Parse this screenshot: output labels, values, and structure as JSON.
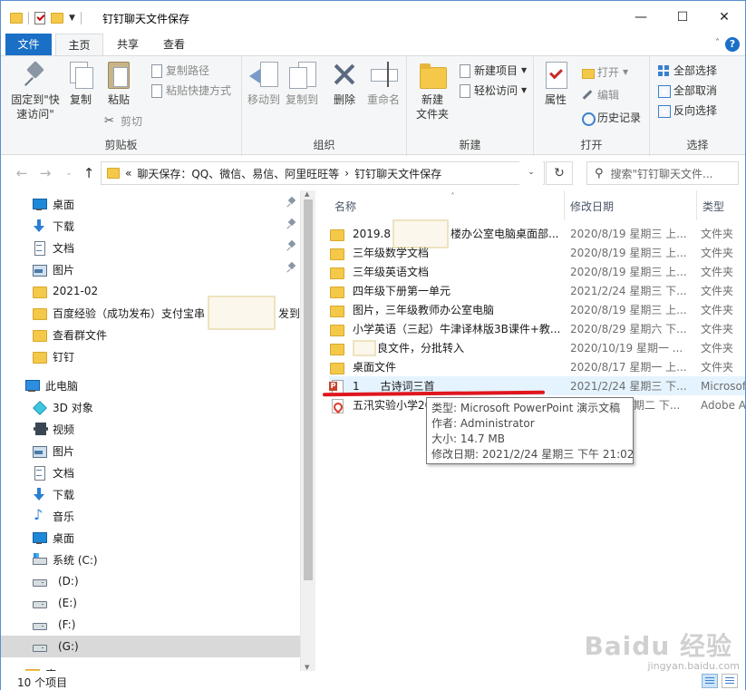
{
  "window": {
    "title": "钉钉聊天文件保存",
    "minimize": "—",
    "maximize": "☐",
    "close": "✕"
  },
  "ribbon_tabs": {
    "file": "文件",
    "home": "主页",
    "share": "共享",
    "view": "查看"
  },
  "ribbon": {
    "clipboard": {
      "label": "剪贴板",
      "pin": "固定到\"快\n速访问\"",
      "copy": "复制",
      "paste": "粘贴",
      "copy_path": "复制路径",
      "paste_shortcut": "粘贴快捷方式",
      "cut": "剪切"
    },
    "organize": {
      "label": "组织",
      "move_to": "移动到",
      "copy_to": "复制到",
      "delete": "删除",
      "rename": "重命名"
    },
    "new": {
      "label": "新建",
      "new_folder": "新建\n文件夹",
      "new_item": "新建项目",
      "easy_access": "轻松访问"
    },
    "open": {
      "label": "打开",
      "properties": "属性",
      "open": "打开",
      "edit": "编辑",
      "history": "历史记录"
    },
    "select": {
      "label": "选择",
      "select_all": "全部选择",
      "select_none": "全部取消",
      "invert": "反向选择"
    }
  },
  "address": {
    "prefix": "«",
    "path": "聊天保存：QQ、微信、易信、阿里旺旺等",
    "sep": "›",
    "current": "钉钉聊天文件保存",
    "search_placeholder": "搜索\"钉钉聊天文件..."
  },
  "nav": {
    "quick_access": [
      {
        "label": "桌面",
        "icon": "desktop-icon",
        "pinned": true
      },
      {
        "label": "下载",
        "icon": "download-icon",
        "pinned": true
      },
      {
        "label": "文档",
        "icon": "document-icon",
        "pinned": true
      },
      {
        "label": "图片",
        "icon": "pictures-icon",
        "pinned": true
      },
      {
        "label": "2021-02",
        "icon": "folder-icon",
        "pinned": false
      },
      {
        "label_a": "百度经验（成功发布）支付宝串",
        "label_b": "发到",
        "icon": "folder-icon",
        "pinned": false
      },
      {
        "label": "查看群文件",
        "icon": "folder-icon",
        "pinned": false
      },
      {
        "label": "钉钉",
        "icon": "folder-icon",
        "pinned": false
      }
    ],
    "this_pc": "此电脑",
    "pc_items": [
      {
        "label": "3D 对象",
        "icon": "3d-objects-icon"
      },
      {
        "label": "视频",
        "icon": "video-icon"
      },
      {
        "label": "图片",
        "icon": "pictures-icon"
      },
      {
        "label": "文档",
        "icon": "document-icon"
      },
      {
        "label": "下载",
        "icon": "download-icon"
      },
      {
        "label": "音乐",
        "icon": "music-icon"
      },
      {
        "label": "桌面",
        "icon": "desktop-icon"
      },
      {
        "label": "系统 (C:)",
        "icon": "system-drive-icon"
      },
      {
        "label": "(D:)",
        "icon": "drive-icon"
      },
      {
        "label": "(E:)",
        "icon": "drive-icon"
      },
      {
        "label": "(F:)",
        "icon": "drive-icon"
      },
      {
        "label": "(G:)",
        "icon": "drive-icon"
      }
    ],
    "partial_item": "库"
  },
  "columns": {
    "name": "名称",
    "date": "修改日期",
    "type": "类型"
  },
  "files": [
    {
      "name_a": "2019.8",
      "name_b": "楼办公室电脑桌面部...",
      "date": "2020/8/19 星期三 上...",
      "type": "文件夹",
      "icon": "folder-icon"
    },
    {
      "name": "三年级数学文档",
      "date": "2020/8/19 星期三 上...",
      "type": "文件夹",
      "icon": "folder-icon"
    },
    {
      "name": "三年级英语文档",
      "date": "2020/8/19 星期三 上...",
      "type": "文件夹",
      "icon": "folder-icon"
    },
    {
      "name": "四年级下册第一单元",
      "date": "2021/2/24 星期三 下...",
      "type": "文件夹",
      "icon": "folder-icon"
    },
    {
      "name": "图片，三年级教师办公室电脑",
      "date": "2020/8/19 星期三 上...",
      "type": "文件夹",
      "icon": "folder-icon"
    },
    {
      "name": "小学英语（三起）牛津译林版3B课件+教...",
      "date": "2020/8/29 星期六 下...",
      "type": "文件夹",
      "icon": "folder-icon"
    },
    {
      "name_b": "良文件，分批转入",
      "date": "2020/10/19 星期一 ...",
      "type": "文件夹",
      "icon": "folder-icon"
    },
    {
      "name": "桌面文件",
      "date": "2020/8/17 星期一 上...",
      "type": "文件夹",
      "icon": "folder-icon"
    },
    {
      "name": "1      古诗词三首",
      "date": "2021/2/24 星期三 下...",
      "type": "Microsoft",
      "icon": "powerpoint-file-icon"
    },
    {
      "name": "五汛实验小学20",
      "date": "星期二 下...",
      "type": "Adobe A",
      "icon": "pdf-file-icon"
    }
  ],
  "tooltip": {
    "type": "类型: Microsoft PowerPoint 演示文稿",
    "author": "作者: Administrator",
    "size": "大小: 14.7 MB",
    "modified": "修改日期: 2021/2/24 星期三 下午 21:02"
  },
  "status": {
    "count": "10 个项目"
  },
  "watermark": {
    "main": "Baidu 经验",
    "sub": "jingyan.baidu.com"
  },
  "colors": {
    "accent": "#1a6fc6",
    "hover_row": "#e5f3ff",
    "underline": "#e0161d"
  }
}
